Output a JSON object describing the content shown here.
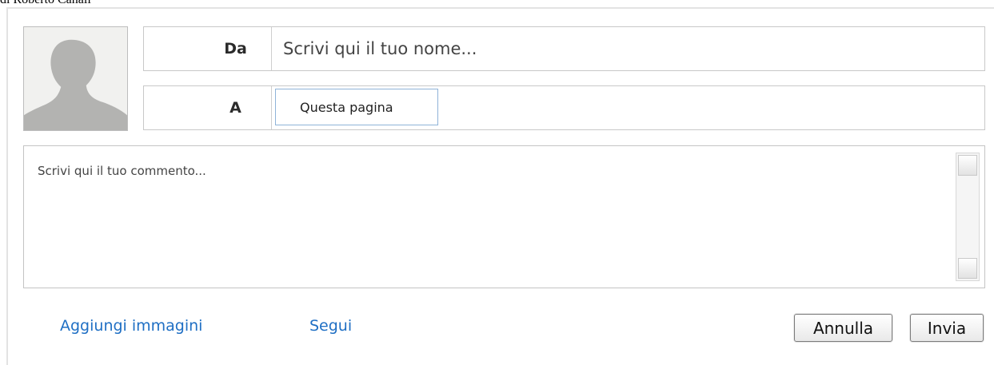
{
  "byline": "di Roberto Canali",
  "comment_form": {
    "from_label": "Da",
    "name_placeholder": "Scrivi qui il tuo nome...",
    "to_label": "A",
    "to_value": "Questa pagina",
    "comment_placeholder": "Scrivi qui il tuo commento...",
    "add_images_label": "Aggiungi immagini",
    "follow_label": "Segui",
    "cancel_label": "Annulla",
    "send_label": "Invia"
  },
  "colors": {
    "link": "#1f6fc4",
    "border": "#c8c8c8",
    "to_field_border": "#8fb3d8",
    "avatar_bg": "#f1f1ef",
    "avatar_silhouette": "#b3b3b1"
  }
}
